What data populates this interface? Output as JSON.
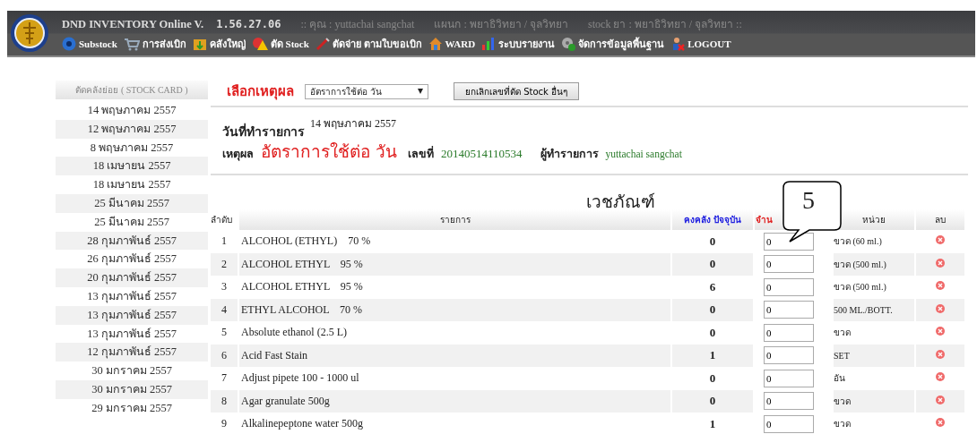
{
  "header": {
    "app_title": "DND INVENTORY Online V.",
    "version": "1.56.27.06",
    "user": ":: คุณ : yuttachai sangchat",
    "department": "แผนก : พยาธิวิทยา / จุลวิทยา",
    "stock": "stock ยา : พยาธิวิทยา / จุลวิทยา ::"
  },
  "menu": [
    {
      "label": "Substock"
    },
    {
      "label": "การส่งเบิก"
    },
    {
      "label": "คลังใหญ่"
    },
    {
      "label": "ตัด Stock"
    },
    {
      "label": "ตัดจ่าย ตามใบขอเบิก"
    },
    {
      "label": "WARD"
    },
    {
      "label": "ระบบรายงาน"
    },
    {
      "label": "จัดการข้อมูลพื้นฐาน"
    },
    {
      "label": "LOGOUT"
    }
  ],
  "sidebar": {
    "title": "ตัดคลังย่อย ( STOCK CARD )",
    "items": [
      "14 พฤษภาคม 2557",
      "12 พฤษภาคม 2557",
      "8 พฤษภาคม 2557",
      "18 เมษายน 2557",
      "18 เมษายน 2557",
      "25 มีนาคม 2557",
      "25 มีนาคม 2557",
      "28 กุมภาพันธ์ 2557",
      "26 กุมภาพันธ์ 2557",
      "20 กุมภาพันธ์ 2557",
      "13 กุมภาพันธ์ 2557",
      "13 กุมภาพันธ์ 2557",
      "13 กุมภาพันธ์ 2557",
      "12 กุมภาพันธ์ 2557",
      "30 มกราคม 2557",
      "30 มกราคม 2557",
      "29 มกราคม 2557"
    ]
  },
  "reason_bar": {
    "label": "เลือกเหตุผล",
    "select_value": "อัตราการใช้ต่อ วัน",
    "button": "ยกเลิกเลขที่ตัด Stock อื่นๆ"
  },
  "info": {
    "date_label": "วันที่ทำรายการ",
    "date": "14 พฤษภาคม 2557",
    "reason_label": "เหตุผล",
    "reason": "อัตราการใช้ต่อ วัน",
    "number_label": "เลขที่",
    "number": "20140514110534",
    "by_label": "ผู้ทำรายการ",
    "by": "yuttachai sangchat"
  },
  "table": {
    "title": "เวชภัณฑ์",
    "columns": [
      "ลำดับ",
      "รายการ",
      "คงคลัง ปัจจุบัน",
      "จำน",
      "หน่วย",
      "ลบ"
    ],
    "rows": [
      {
        "no": "1",
        "name": "ALCOHOL (ETHYL)    70 %",
        "stock": "0",
        "qty": "0",
        "unit": "ขวด (60 ml.)"
      },
      {
        "no": "2",
        "name": "ALCOHOL ETHYL    95 %",
        "stock": "0",
        "qty": "0",
        "unit": "ขวด (500 ml.)"
      },
      {
        "no": "3",
        "name": "ALCOHOL ETHYL    95 %",
        "stock": "6",
        "qty": "0",
        "unit": "ขวด (500 ml.)"
      },
      {
        "no": "4",
        "name": "ETHYL ALCOHOL    70 %",
        "stock": "0",
        "qty": "0",
        "unit": "500 ML./BOTT."
      },
      {
        "no": "5",
        "name": "Absolute ethanol (2.5 L)",
        "stock": "0",
        "qty": "0",
        "unit": "ขวด"
      },
      {
        "no": "6",
        "name": "Acid Fast Stain",
        "stock": "1",
        "qty": "0",
        "unit": "SET"
      },
      {
        "no": "7",
        "name": "Adjust pipete 100 - 1000 ul",
        "stock": "0",
        "qty": "0",
        "unit": "อัน"
      },
      {
        "no": "8",
        "name": "Agar granulate 500g",
        "stock": "0",
        "qty": "0",
        "unit": "ขวด"
      },
      {
        "no": "9",
        "name": "Alkalinepeptone water 500g",
        "stock": "1",
        "qty": "0",
        "unit": "ขวด"
      }
    ]
  },
  "callout": {
    "text": "5"
  }
}
